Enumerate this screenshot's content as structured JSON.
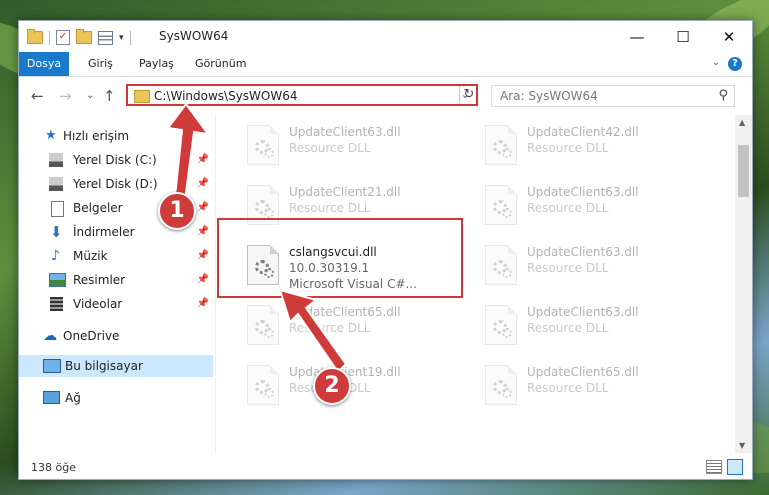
{
  "window": {
    "title": "SysWOW64"
  },
  "ribbon": {
    "tabs": [
      "Dosya",
      "Giriş",
      "Paylaş",
      "Görünüm"
    ]
  },
  "nav": {
    "address": "C:\\Windows\\SysWOW64",
    "search_placeholder": "Ara: SysWOW64"
  },
  "sidebar": {
    "quick_access": "Hızlı erişim",
    "items": [
      "Yerel Disk (C:)",
      "Yerel Disk (D:)",
      "Belgeler",
      "İndirmeler",
      "Müzik",
      "Resimler",
      "Videolar"
    ],
    "onedrive": "OneDrive",
    "this_pc": "Bu bilgisayar",
    "network": "Ağ"
  },
  "files": {
    "left": [
      {
        "name": "UpdateClient63.dll",
        "desc": "Resource DLL"
      },
      {
        "name": "UpdateClient21.dll",
        "desc": "Resource DLL"
      },
      {
        "name": "cslangsvcui.dll",
        "version": "10.0.30319.1",
        "desc": "Microsoft Visual C#..."
      },
      {
        "name": "UpdateClient65.dll",
        "desc": "Resource DLL"
      },
      {
        "name": "UpdateClient19.dll",
        "desc": "Resource DLL"
      }
    ],
    "right": [
      {
        "name": "UpdateClient42.dll",
        "desc": "Resource DLL"
      },
      {
        "name": "UpdateClient63.dll",
        "desc": "Resource DLL"
      },
      {
        "name": "UpdateClient63.dll",
        "desc": "Resource DLL"
      },
      {
        "name": "UpdateClient63.dll",
        "desc": "Resource DLL"
      },
      {
        "name": "UpdateClient65.dll",
        "desc": "Resource DLL"
      }
    ]
  },
  "status": {
    "count": "138 öğe"
  },
  "annotations": {
    "step1": "1",
    "step2": "2"
  },
  "colors": {
    "accent": "#1979ca",
    "highlight": "#d03838"
  }
}
